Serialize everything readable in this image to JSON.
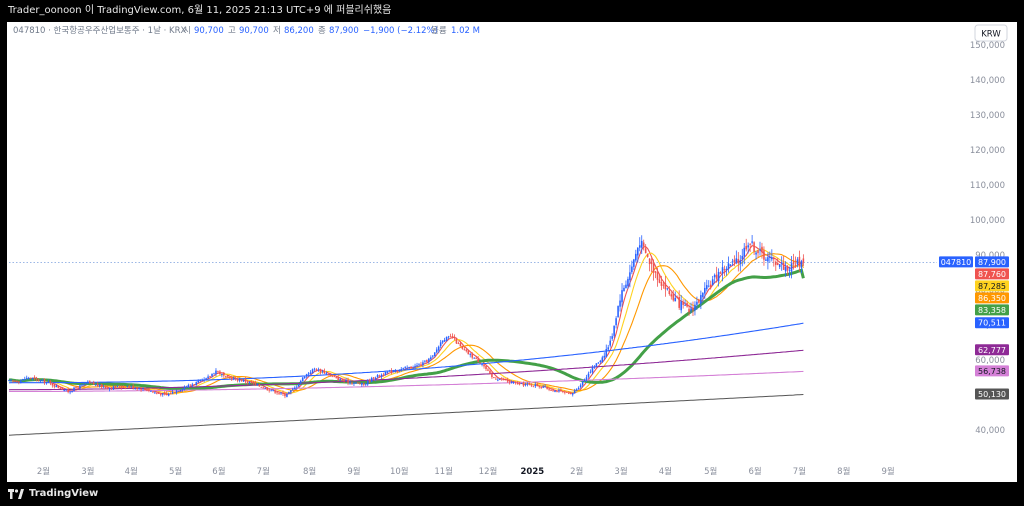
{
  "header": {
    "publish_text": "Trader_oonoon 이 TradingView.com, 6월 11, 2025 21:13 UTC+9 에 퍼블리쉬했음"
  },
  "legend": {
    "symbol": "047810 · 한국항공우주산업보통주 · 1날 · KRX",
    "open_label": "시",
    "open_value": "90,700",
    "high_label": "고",
    "high_value": "90,700",
    "low_label": "저",
    "low_value": "86,200",
    "close_label": "종",
    "close_value": "87,900",
    "change": "−1,900 (−2.12%)",
    "volume_label": "볼륨",
    "volume_value": "1.02 M"
  },
  "currency": "KRW",
  "footer": {
    "logo_text": "TradingView"
  },
  "colors": {
    "up": "#2962ff",
    "down": "#ef5350",
    "ma_red": "#ef5350",
    "ma_yellow": "#ffd21f",
    "ma_orange": "#ff9800",
    "ma_green": "#43a047",
    "ma_blue": "#4f7be8",
    "ma_purple": "#8e2a96",
    "ma_pink": "#d480d6",
    "ma_gray": "#555555",
    "price_line": "#7b9fdd"
  },
  "chart_data": {
    "type": "candlestick",
    "x_ticks": [
      "2월",
      "3월",
      "4월",
      "5월",
      "6월",
      "7월",
      "8월",
      "9월",
      "10월",
      "11월",
      "12월",
      "2025",
      "2월",
      "3월",
      "4월",
      "5월",
      "6월",
      "7월",
      "8월",
      "9월"
    ],
    "y_ticks": [
      40000,
      50000,
      60000,
      70000,
      80000,
      90000,
      100000,
      110000,
      120000,
      130000,
      140000,
      150000
    ],
    "y_tick_labels": [
      "40,000",
      "50,000",
      "60,000",
      "70,000",
      "80,000",
      "90,000",
      "100,000",
      "110,000",
      "120,000",
      "130,000",
      "140,000",
      "150,000"
    ],
    "ylim": [
      32000,
      152000
    ],
    "price_labels": [
      {
        "text": "87,900",
        "value": 87900,
        "color": "#2962ff",
        "symbol": "047810"
      },
      {
        "text": "87,760",
        "value": 87760,
        "color": "#ef5350"
      },
      {
        "text": "87,285",
        "value": 87285,
        "color": "#ffd21f"
      },
      {
        "text": "86,350",
        "value": 86350,
        "color": "#ff9800"
      },
      {
        "text": "83,358",
        "value": 83358,
        "color": "#43a047"
      },
      {
        "text": "70,511",
        "value": 70511,
        "color": "#2962ff"
      },
      {
        "text": "62,777",
        "value": 62777,
        "color": "#8e2a96"
      },
      {
        "text": "56,738",
        "value": 56738,
        "color": "#d480d6"
      },
      {
        "text": "50,130",
        "value": 50130,
        "color": "#555555"
      }
    ],
    "close_anchors": [
      [
        1,
        54000
      ],
      [
        2,
        55000
      ],
      [
        4,
        53500
      ],
      [
        6,
        51000
      ],
      [
        8,
        53500
      ],
      [
        10,
        52000
      ],
      [
        12,
        52500
      ],
      [
        14,
        51500
      ],
      [
        15,
        50500
      ],
      [
        16,
        50000
      ],
      [
        18,
        52500
      ],
      [
        19,
        53500
      ],
      [
        20,
        54500
      ],
      [
        21,
        57000
      ],
      [
        22,
        55000
      ],
      [
        23,
        54500
      ],
      [
        24,
        54000
      ],
      [
        26,
        52000
      ],
      [
        27,
        51000
      ],
      [
        28,
        50000
      ],
      [
        29,
        52000
      ],
      [
        30,
        55500
      ],
      [
        31,
        57500
      ],
      [
        32,
        56500
      ],
      [
        33,
        55000
      ],
      [
        34,
        54000
      ],
      [
        35,
        53500
      ],
      [
        36,
        53000
      ],
      [
        37,
        55000
      ],
      [
        38,
        56000
      ],
      [
        39,
        57000
      ],
      [
        40,
        57500
      ],
      [
        41,
        58000
      ],
      [
        42,
        59000
      ],
      [
        43,
        61000
      ],
      [
        44,
        66000
      ],
      [
        45,
        66500
      ],
      [
        46,
        63000
      ],
      [
        47,
        61000
      ],
      [
        48,
        59000
      ],
      [
        49,
        55000
      ],
      [
        50,
        54500
      ],
      [
        51,
        53500
      ],
      [
        52,
        53000
      ],
      [
        53,
        53000
      ],
      [
        54,
        52500
      ],
      [
        55,
        51500
      ],
      [
        56,
        51000
      ],
      [
        57,
        50000
      ],
      [
        58,
        53000
      ],
      [
        59,
        57000
      ],
      [
        60,
        60000
      ],
      [
        61,
        65000
      ],
      [
        62,
        78000
      ],
      [
        63,
        85000
      ],
      [
        64,
        94000
      ],
      [
        65,
        88000
      ],
      [
        66,
        83000
      ],
      [
        67,
        79000
      ],
      [
        68,
        76000
      ],
      [
        69,
        74000
      ],
      [
        70,
        77000
      ],
      [
        71,
        81000
      ],
      [
        72,
        85000
      ],
      [
        73,
        87000
      ],
      [
        74,
        88000
      ],
      [
        75,
        94000
      ],
      [
        76,
        91000
      ],
      [
        77,
        89000
      ],
      [
        78,
        88000
      ],
      [
        79,
        86000
      ],
      [
        80,
        88000
      ],
      [
        80.6,
        87900
      ]
    ],
    "moving_averages": [
      {
        "period": 5,
        "last": 87760,
        "color": "#ef5350"
      },
      {
        "period": 10,
        "last": 87285,
        "color": "#ffd21f"
      },
      {
        "period": 20,
        "last": 86350,
        "color": "#ff9800"
      },
      {
        "period": 60,
        "last": 83358,
        "color": "#43a047"
      },
      {
        "period": 120,
        "last": 70511,
        "color": "#2962ff"
      },
      {
        "period": 240,
        "last": 62777,
        "color": "#8e2a96"
      },
      {
        "period": 360,
        "last": 56738,
        "color": "#d480d6"
      },
      {
        "period": 720,
        "last": 50130,
        "color": "#555555"
      }
    ],
    "last_price": 87900,
    "grid": false
  }
}
